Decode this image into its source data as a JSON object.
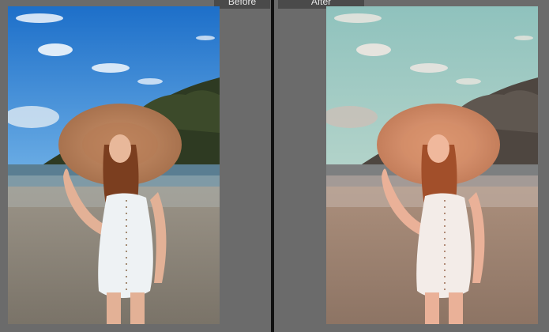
{
  "labels": {
    "before": "Before",
    "after": "After"
  },
  "colors": {
    "background": "#6b6b6b",
    "divider": "#111111",
    "label_tab": "#4a4a4a",
    "before_sky_top": "#1d6fc9",
    "before_sky_bottom": "#cfe6f6",
    "after_sky_top": "#8fc2bd",
    "after_sky_bottom": "#d7d2c4"
  },
  "icons": {
    "photo_subject": "woman-in-sun-hat-photo"
  }
}
